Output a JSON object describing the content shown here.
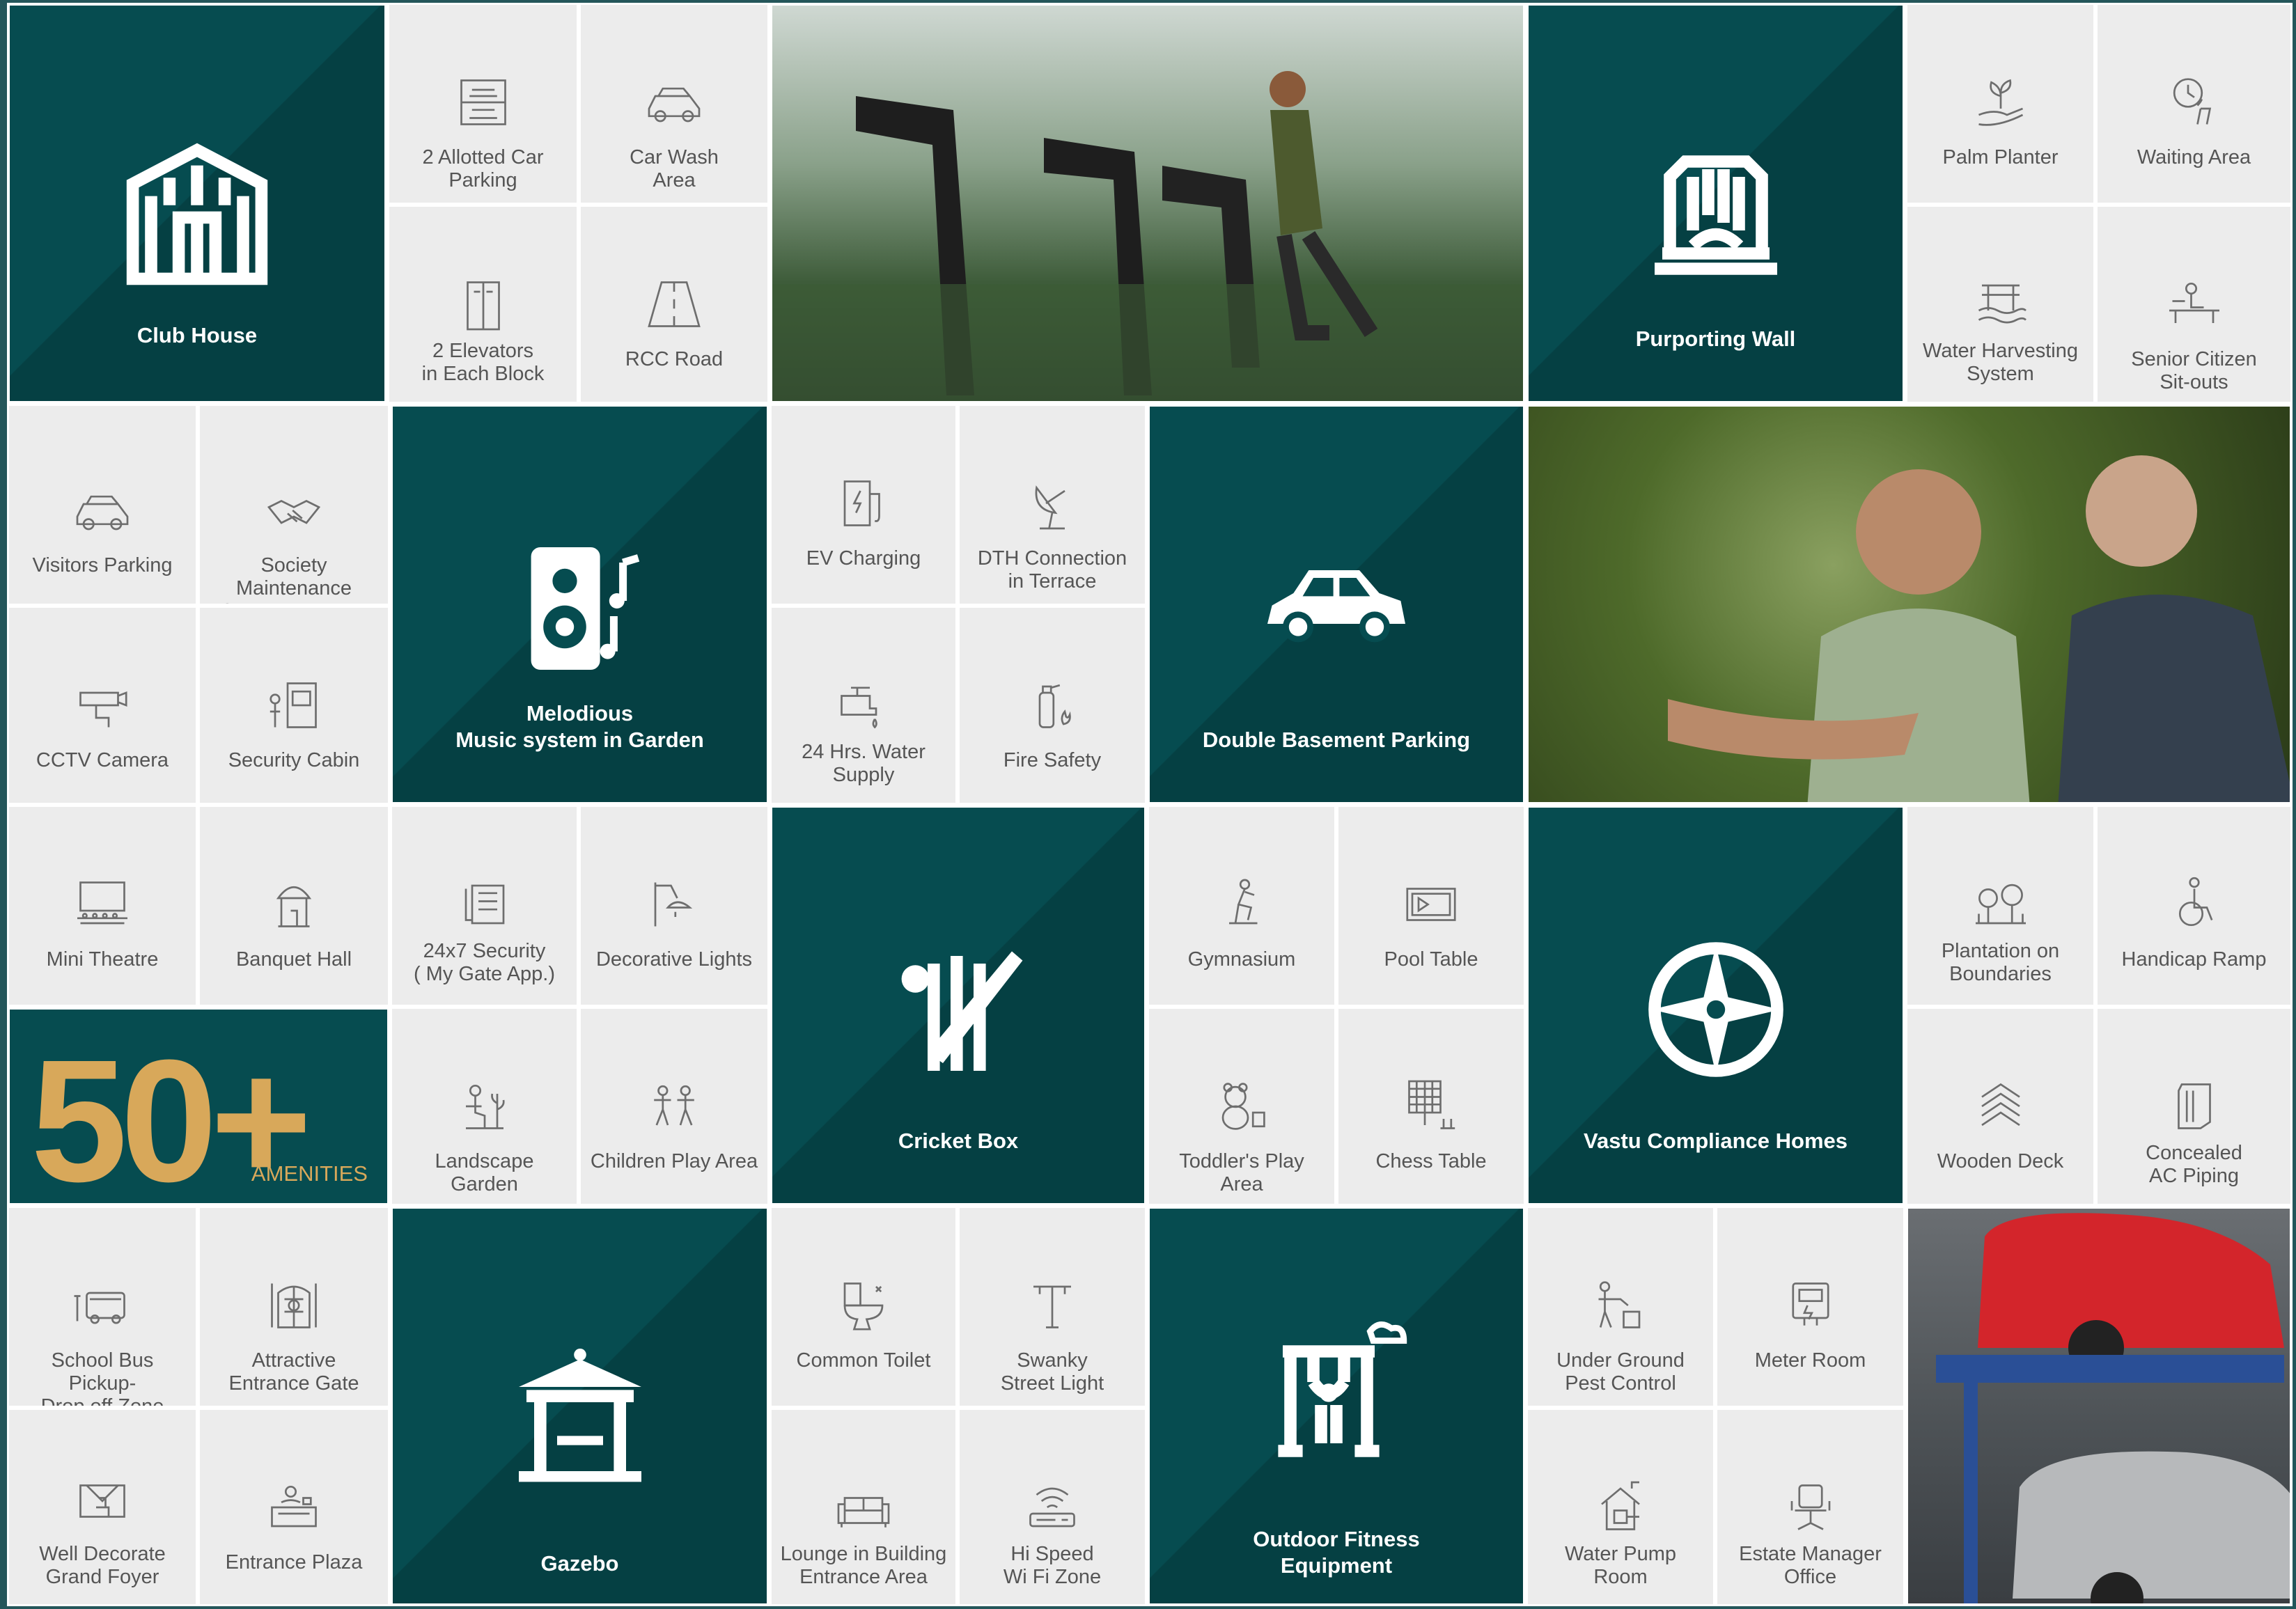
{
  "tiles": {
    "club_house": "Club House",
    "allotted_parking": "2 Allotted Car\nParking",
    "car_wash": "Car Wash\nArea",
    "elevators": "2 Elevators\nin Each Block",
    "rcc_road": "RCC Road",
    "purporting_wall": "Purporting Wall",
    "palm_planter": "Palm Planter",
    "waiting_area": "Waiting Area",
    "water_harvesting": "Water Harvesting\nSystem",
    "senior_citizen": "Senior Citizen\nSit-outs",
    "visitors_parking": "Visitors Parking",
    "society_maintenance": "Society Maintenance\nContract Agency",
    "melodious_music": "Melodious\nMusic system in Garden",
    "ev_charging": "EV Charging",
    "dth_connection": "DTH Connection\nin Terrace",
    "double_basement": "Double Basement Parking",
    "cctv": "CCTV Camera",
    "security_cabin": "Security Cabin",
    "water_supply": "24 Hrs. Water\nSupply",
    "fire_safety": "Fire Safety",
    "mini_theatre": "Mini Theatre",
    "banquet_hall": "Banquet Hall",
    "security_24x7": "24x7 Security\n( My Gate App.)",
    "decorative_lights": "Decorative Lights",
    "cricket_box": "Cricket Box",
    "gymnasium": "Gymnasium",
    "pool_table": "Pool Table",
    "vastu": "Vastu Compliance Homes",
    "plantation": "Plantation on\nBoundaries",
    "handicap_ramp": "Handicap Ramp",
    "landscape_garden": "Landscape Garden",
    "children_play": "Children Play Area",
    "toddlers_play": "Toddler's Play Area",
    "chess_table": "Chess Table",
    "wooden_deck": "Wooden Deck",
    "concealed_ac": "Concealed\nAC Piping",
    "school_bus": "School Bus Pickup-\nDrop off Zone",
    "entrance_gate": "Attractive\nEntrance Gate",
    "gazebo": "Gazebo",
    "common_toilet": "Common Toilet",
    "street_light": "Swanky\nStreet Light",
    "outdoor_fitness": "Outdoor Fitness\nEquipment",
    "pest_control": "Under Ground\nPest Control",
    "meter_room": "Meter Room",
    "grand_foyer": "Well Decorate\nGrand Foyer",
    "entrance_plaza": "Entrance Plaza",
    "lounge": "Lounge in Building\nEntrance Area",
    "wifi": "Hi Speed\nWi Fi Zone",
    "water_pump": "Water Pump\nRoom",
    "estate_manager": "Estate Manager\nOffice"
  },
  "badge": {
    "number": "50+",
    "caption": "AMENITIES"
  },
  "colors": {
    "teal": "#064c50",
    "gold": "#d8a85a",
    "tile_gray": "#ececec"
  }
}
